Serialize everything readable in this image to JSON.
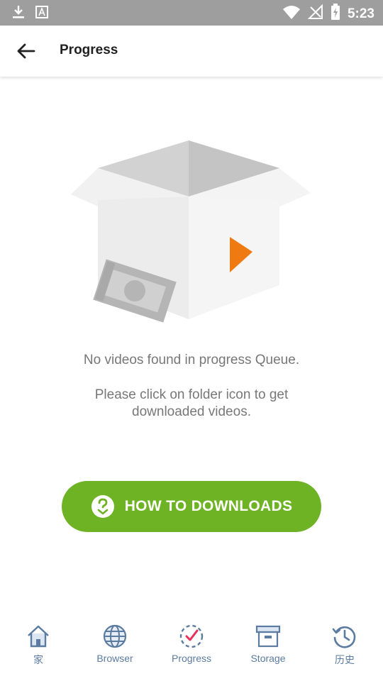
{
  "status_bar": {
    "time": "5:23",
    "icons": [
      "download-icon",
      "a-icon",
      "wifi-icon",
      "no-signal-icon",
      "battery-charging-icon"
    ]
  },
  "app_bar": {
    "title": "Progress",
    "back_icon": "arrow-left-icon"
  },
  "empty_state": {
    "message_primary": "No videos found in progress Queue.",
    "message_secondary": "Please click on folder icon to get downloaded videos."
  },
  "how_button": {
    "label": "HOW TO DOWNLOADS",
    "icon": "question-download-icon",
    "color": "#6db324"
  },
  "bottom_nav": {
    "items": [
      {
        "label": "家",
        "icon": "home-icon"
      },
      {
        "label": "Browser",
        "icon": "globe-icon"
      },
      {
        "label": "Progress",
        "icon": "progress-check-icon"
      },
      {
        "label": "Storage",
        "icon": "archive-box-icon"
      },
      {
        "label": "历史",
        "icon": "history-icon"
      }
    ],
    "active_index": 2,
    "label_color": "#5b7ba0"
  },
  "colors": {
    "status_bar": "#9e9e9e",
    "accent_orange": "#f07a12",
    "accent_pink": "#e8315a"
  }
}
